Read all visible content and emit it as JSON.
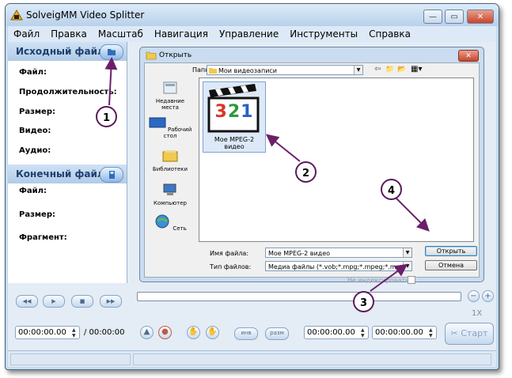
{
  "window": {
    "title": "SolveigMM Video Splitter",
    "controls": {
      "minimize": "—",
      "maximize": "▭",
      "close": "✕"
    }
  },
  "menu": [
    "Файл",
    "Правка",
    "Масштаб",
    "Навигация",
    "Управление",
    "Инструменты",
    "Справка"
  ],
  "source_panel": {
    "header": "Исходный файл",
    "fields": [
      "Файл:",
      "Продолжительность:",
      "Размер:",
      "Видео:",
      "Аудио:"
    ]
  },
  "target_panel": {
    "header": "Конечный файл",
    "fields": [
      "Файл:",
      "Размер:",
      "Фрагмент:"
    ]
  },
  "dialog": {
    "title": "Открыть",
    "folder_label": "Папка:",
    "folder_value": "Мои видеозаписи",
    "places": [
      "Недавние места",
      "Рабочий стол",
      "Библиотеки",
      "Компьютер",
      "Сеть"
    ],
    "file": {
      "name": "Мое MPEG-2 видео",
      "icon_text": "321"
    },
    "filename_label": "Имя файла:",
    "filename_value": "Мое MPEG-2 видео",
    "filetype_label": "Тип файлов:",
    "filetype_value": "Медиа файлы (*.vob;*.mpg;*.mpeg;*.mpv;*.m2",
    "open_button": "Открыть",
    "cancel_button": "Отмена",
    "not_indexed_label": "Не индексировать"
  },
  "annotations": [
    "1",
    "2",
    "3",
    "4"
  ],
  "player": {
    "time_current": "00:00:00.00",
    "time_total": "/ 00:00:00",
    "marker_in": "инв",
    "marker_out": "разм",
    "time_from": "00:00:00.00",
    "time_to": "00:00:00.00",
    "zoom": "1X",
    "start_button": "Старт"
  }
}
